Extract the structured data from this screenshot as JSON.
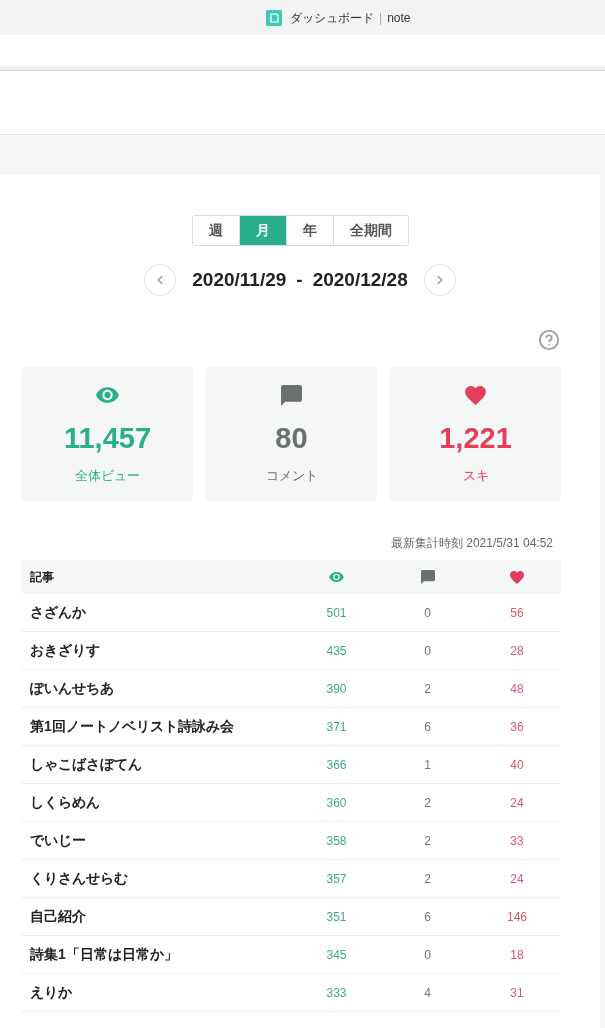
{
  "browser_tab": {
    "title": "ダッシュボード",
    "separator": "|",
    "site": "note"
  },
  "period_tabs": [
    {
      "label": "週",
      "selected": false
    },
    {
      "label": "月",
      "selected": true
    },
    {
      "label": "年",
      "selected": false
    },
    {
      "label": "全期間",
      "selected": false
    }
  ],
  "date_range": {
    "start": "2020/11/29",
    "separator": "-",
    "end": "2020/12/28"
  },
  "stats": [
    {
      "kind": "views",
      "value": "11,457",
      "label": "全体ビュー",
      "color": "#2bae8c"
    },
    {
      "kind": "comments",
      "value": "80",
      "label": "コメント",
      "color": "#6b6f6f"
    },
    {
      "kind": "likes",
      "value": "1,221",
      "label": "スキ",
      "color": "#e33f5d"
    }
  ],
  "updated_at": "最新集計時刻 2021/5/31 04:52",
  "table": {
    "columns": [
      {
        "kind": "title",
        "label": "記事"
      },
      {
        "kind": "views"
      },
      {
        "kind": "comments"
      },
      {
        "kind": "likes"
      }
    ],
    "rows": [
      {
        "title": "さざんか",
        "views": "501",
        "comments": "0",
        "likes": "56"
      },
      {
        "title": "おきざりす",
        "views": "435",
        "comments": "0",
        "likes": "28"
      },
      {
        "title": "ぽいんせちあ",
        "views": "390",
        "comments": "2",
        "likes": "48"
      },
      {
        "title": "第1回ノートノベリスト詩詠み会",
        "views": "371",
        "comments": "6",
        "likes": "36"
      },
      {
        "title": "しゃこばさぼてん",
        "views": "366",
        "comments": "1",
        "likes": "40"
      },
      {
        "title": "しくらめん",
        "views": "360",
        "comments": "2",
        "likes": "24"
      },
      {
        "title": "でいじー",
        "views": "358",
        "comments": "2",
        "likes": "33"
      },
      {
        "title": "くりさんせらむ",
        "views": "357",
        "comments": "2",
        "likes": "24"
      },
      {
        "title": "自己紹介",
        "views": "351",
        "comments": "6",
        "likes": "146"
      },
      {
        "title": "詩集1「日常は日常か」",
        "views": "345",
        "comments": "0",
        "likes": "18"
      },
      {
        "title": "えりか",
        "views": "333",
        "comments": "4",
        "likes": "31"
      }
    ]
  }
}
